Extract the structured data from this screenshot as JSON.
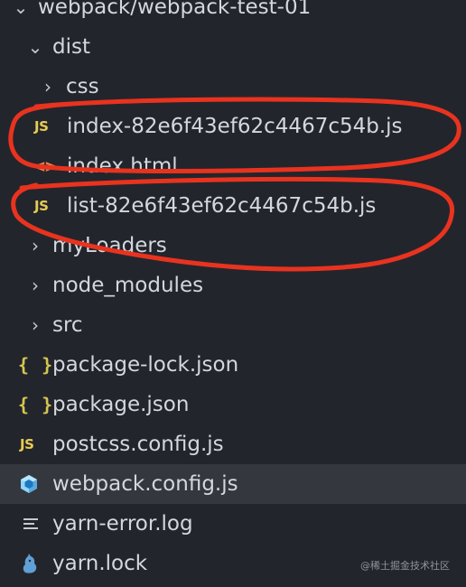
{
  "tree": {
    "root_label": "webpack/webpack-test-01",
    "items": [
      {
        "label": "dist"
      },
      {
        "label": "css"
      },
      {
        "label": "index-82e6f43ef62c4467c54b.js",
        "badge": "JS"
      },
      {
        "label": "index.html",
        "badge": "<>"
      },
      {
        "label": "list-82e6f43ef62c4467c54b.js",
        "badge": "JS"
      },
      {
        "label": "myLoaders"
      },
      {
        "label": "node_modules"
      },
      {
        "label": "src"
      },
      {
        "label": "package-lock.json",
        "badge": "{ }"
      },
      {
        "label": "package.json",
        "badge": "{ }"
      },
      {
        "label": "postcss.config.js",
        "badge": "JS"
      },
      {
        "label": "webpack.config.js",
        "selected": true
      },
      {
        "label": "yarn-error.log"
      },
      {
        "label": "yarn.lock"
      }
    ]
  },
  "watermark": "@稀土掘金技术社区",
  "colors": {
    "background": "#23252c",
    "selected_row": "#35373f",
    "annotation_red": "#e8331f",
    "js_icon": "#e7cc53",
    "html_icon": "#e8804d",
    "webpack_icon": "#6db3e6",
    "yarn_icon": "#5fa0d6"
  }
}
